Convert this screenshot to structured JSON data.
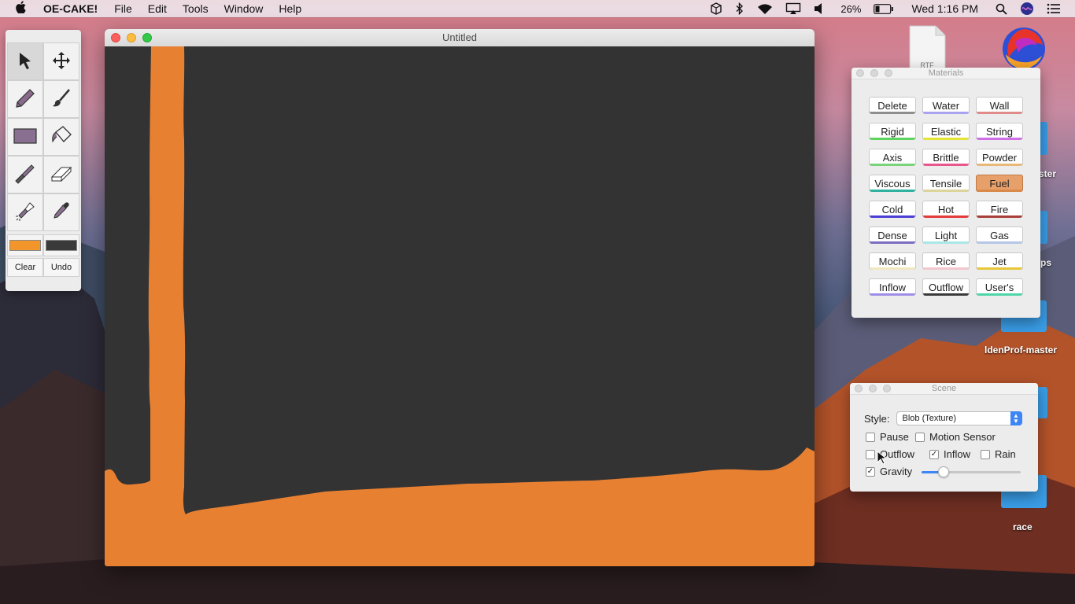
{
  "menubar": {
    "app_name": "OE-CAKE!",
    "menus": [
      "File",
      "Edit",
      "Tools",
      "Window",
      "Help"
    ],
    "battery": "26%",
    "clock": "Wed 1:16 PM"
  },
  "tools": {
    "clear_label": "Clear",
    "undo_label": "Undo",
    "primary_color": "#f2962b",
    "secondary_color": "#3a3a3a"
  },
  "window": {
    "title": "Untitled",
    "canvas_bg": "#333333",
    "fluid_color": "#e88032"
  },
  "desktop": {
    "labels": [
      "ster",
      "ps",
      "ldenProf-master",
      "race"
    ],
    "file_badge": "RTF"
  },
  "materials": {
    "title": "Materials",
    "items": [
      {
        "label": "Delete",
        "color": "#8e8e8e"
      },
      {
        "label": "Water",
        "color": "#a9a2f0"
      },
      {
        "label": "Wall",
        "color": "#e08a8a"
      },
      {
        "label": "Rigid",
        "color": "#5ed35e"
      },
      {
        "label": "Elastic",
        "color": "#e5e535"
      },
      {
        "label": "String",
        "color": "#cf6ee8"
      },
      {
        "label": "Axis",
        "color": "#7ad37a"
      },
      {
        "label": "Brittle",
        "color": "#e8578c"
      },
      {
        "label": "Powder",
        "color": "#e8b878"
      },
      {
        "label": "Viscous",
        "color": "#2fb3a0"
      },
      {
        "label": "Tensile",
        "color": "#dcd49a"
      },
      {
        "label": "Fuel",
        "color": "#d9894a"
      },
      {
        "label": "Cold",
        "color": "#4b3fd6"
      },
      {
        "label": "Hot",
        "color": "#e33a3a"
      },
      {
        "label": "Fire",
        "color": "#a8403a"
      },
      {
        "label": "Dense",
        "color": "#7a6ec0"
      },
      {
        "label": "Light",
        "color": "#a9e6e6"
      },
      {
        "label": "Gas",
        "color": "#b6c6e6"
      },
      {
        "label": "Mochi",
        "color": "#f0e8c0"
      },
      {
        "label": "Rice",
        "color": "#f2c6cf"
      },
      {
        "label": "Jet",
        "color": "#e8c63a"
      },
      {
        "label": "Inflow",
        "color": "#9f8ee8"
      },
      {
        "label": "Outflow",
        "color": "#3a3a3a"
      },
      {
        "label": "User's",
        "color": "#4fd6a8"
      }
    ],
    "selected": "Fuel"
  },
  "scene": {
    "title": "Scene",
    "style_label": "Style:",
    "style_value": "Blob (Texture)",
    "pause_label": "Pause",
    "pause_checked": false,
    "motion_label": "Motion Sensor",
    "motion_checked": false,
    "outflow_label": "Outflow",
    "outflow_checked": false,
    "inflow_label": "Inflow",
    "inflow_checked": true,
    "rain_label": "Rain",
    "rain_checked": false,
    "gravity_label": "Gravity",
    "gravity_checked": true,
    "gravity_level": 0.22
  }
}
